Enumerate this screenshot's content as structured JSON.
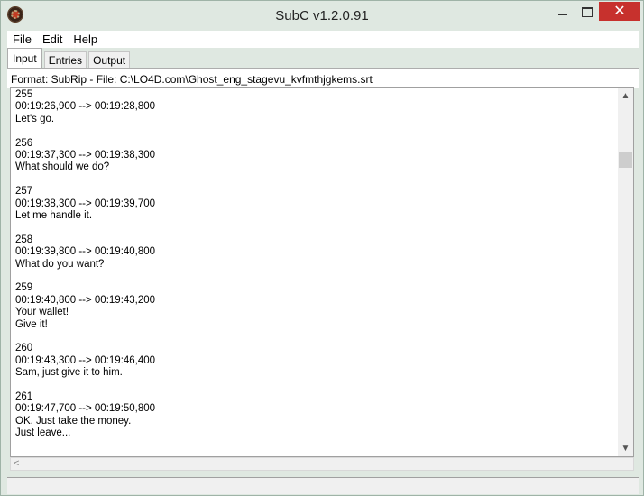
{
  "window": {
    "title": "SubC v1.2.0.91",
    "controls": {
      "minimize_icon": "minimize-icon",
      "maximize_icon": "maximize-icon",
      "close_label": "✕"
    }
  },
  "menu": {
    "items": [
      "File",
      "Edit",
      "Help"
    ]
  },
  "tabs": [
    {
      "label": "Input",
      "active": true
    },
    {
      "label": "Entries",
      "active": false
    },
    {
      "label": "Output",
      "active": false
    }
  ],
  "format_line": "Format: SubRip - File: C:\\LO4D.com\\Ghost_eng_stagevu_kvfmthjgkems.srt",
  "entries": [
    {
      "number": "255",
      "timing": "00:19:26,900 --> 00:19:28,800",
      "lines": [
        "Let's go."
      ]
    },
    {
      "number": "256",
      "timing": "00:19:37,300 --> 00:19:38,300",
      "lines": [
        "What should we do?"
      ]
    },
    {
      "number": "257",
      "timing": "00:19:38,300 --> 00:19:39,700",
      "lines": [
        "Let me handle it."
      ]
    },
    {
      "number": "258",
      "timing": "00:19:39,800 --> 00:19:40,800",
      "lines": [
        "What do you want?"
      ]
    },
    {
      "number": "259",
      "timing": "00:19:40,800 --> 00:19:43,200",
      "lines": [
        "Your wallet!",
        "Give it!"
      ]
    },
    {
      "number": "260",
      "timing": "00:19:43,300 --> 00:19:46,400",
      "lines": [
        "Sam, just give it to him."
      ]
    },
    {
      "number": "261",
      "timing": "00:19:47,700 --> 00:19:50,800",
      "lines": [
        "OK. Just take the money.",
        "Just leave..."
      ]
    }
  ],
  "colors": {
    "chrome": "#dfe8e1",
    "close_button": "#c7312d"
  }
}
